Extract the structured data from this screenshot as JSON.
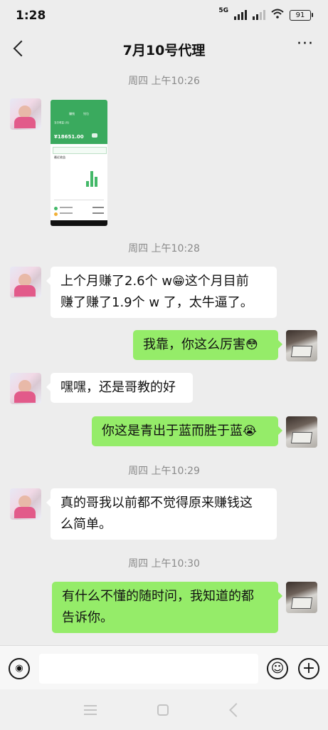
{
  "status_bar": {
    "time": "1:28",
    "network": "5G",
    "battery": "91"
  },
  "header": {
    "title": "7月10号代理",
    "back_icon": "chevron-left-icon",
    "more_icon": "more-icon",
    "more_glyph": "···"
  },
  "screenshot_thumb": {
    "tab_active": "赚钱",
    "tab_inactive": "钱包",
    "label": "当日收益 (元)",
    "amount": "¥18651.00",
    "section": "最近收益"
  },
  "messages": [
    {
      "type": "timestamp",
      "text": "周四 上午10:26"
    },
    {
      "type": "image",
      "from": "her"
    },
    {
      "type": "timestamp",
      "text": "周四 上午10:28"
    },
    {
      "type": "text",
      "from": "her",
      "line1_a": "上个月赚了2.6个 w",
      "line1_emoji": "😁",
      "line1_b": "这个月目前",
      "line2": "赚了赚了1.9个 w 了，太牛逼了。"
    },
    {
      "type": "text",
      "from": "me",
      "text": "我靠，你这么厉害",
      "emoji": "😳"
    },
    {
      "type": "text",
      "from": "her",
      "text": "嘿嘿，还是哥教的好"
    },
    {
      "type": "text",
      "from": "me",
      "text": "你这是青出于蓝而胜于蓝",
      "emoji": "😭"
    },
    {
      "type": "timestamp",
      "text": "周四 上午10:29"
    },
    {
      "type": "text",
      "from": "her",
      "line1": "真的哥我以前都不觉得原来赚钱这",
      "line2": "么简单。"
    },
    {
      "type": "timestamp",
      "text": "周四 上午10:30"
    },
    {
      "type": "text",
      "from": "me",
      "line1": "有什么不懂的随时问，我知道的都",
      "line2": "告诉你。"
    }
  ],
  "input_bar": {
    "voice_glyph": "◉",
    "input_value": "",
    "emoji_glyph": "☺",
    "plus_glyph": "+"
  },
  "colors": {
    "my_bubble": "#95ec69",
    "their_bubble": "#ffffff",
    "background": "#ededed"
  }
}
